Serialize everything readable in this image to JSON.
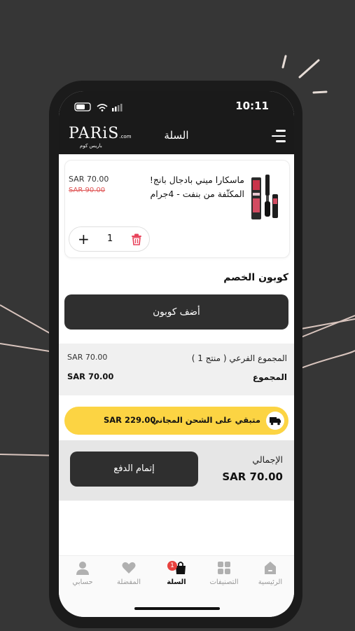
{
  "status_bar": {
    "time": "10:11"
  },
  "header": {
    "logo": "PARiS",
    "logo_suffix": ".com",
    "logo_sub": "باريس كوم",
    "title": "السلة"
  },
  "cart_item": {
    "name": "ماسكارا ميني بادجال بانج! المكثّفة من بنفت - 4جرام",
    "price": "SAR 70.00",
    "old_price": "SAR 90.00",
    "quantity": "1"
  },
  "coupon": {
    "title": "كوبون الخصم",
    "button_label": "أضف كوبون"
  },
  "summary": {
    "subtotal_label": "المجموع الفرعي ( منتج 1 )",
    "subtotal_value": "SAR 70.00",
    "total_label": "المجموع",
    "total_value": "SAR 70.00"
  },
  "shipping_banner": {
    "text": "متبقي على الشحن المجاني",
    "amount": "SAR 229.00",
    "color": "#fcd443"
  },
  "grand_total": {
    "label": "الإجمالي",
    "value": "SAR 70.00",
    "checkout_label": "إتمام الدفع"
  },
  "tabs": [
    {
      "label": "الرئيسية",
      "icon": "home-icon"
    },
    {
      "label": "التصنيفات",
      "icon": "categories-icon"
    },
    {
      "label": "السلة",
      "icon": "cart-icon",
      "badge": "1",
      "active": true
    },
    {
      "label": "المفضلة",
      "icon": "heart-icon"
    },
    {
      "label": "حسابي",
      "icon": "user-icon"
    }
  ],
  "colors": {
    "dark": "#2f2f2f",
    "accent_yellow": "#fcd443",
    "badge_red": "#e8423f",
    "old_price_red": "#e05858"
  }
}
